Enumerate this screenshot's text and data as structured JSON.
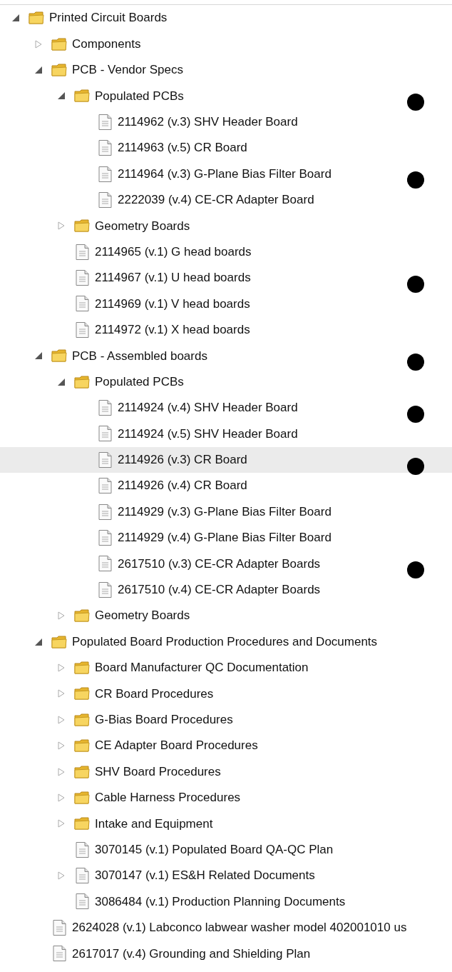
{
  "tree": [
    {
      "kind": "folder",
      "label": "Printed Circuit Boards",
      "expanded": true,
      "selected": false,
      "children": [
        {
          "kind": "folder",
          "label": "Components",
          "expanded": false,
          "selected": false
        },
        {
          "kind": "folder",
          "label": "PCB - Vendor Specs",
          "expanded": true,
          "selected": false,
          "children": [
            {
              "kind": "folder",
              "label": "Populated PCBs",
              "expanded": true,
              "selected": false,
              "dot": true,
              "children": [
                {
                  "kind": "file",
                  "label": "2114962 (v.3) SHV Header Board",
                  "selected": false
                },
                {
                  "kind": "file",
                  "label": "2114963 (v.5) CR Board",
                  "selected": false
                },
                {
                  "kind": "file",
                  "label": "2114964 (v.3) G-Plane Bias Filter Board",
                  "selected": false,
                  "dot": true
                },
                {
                  "kind": "file",
                  "label": "2222039 (v.4) CE-CR Adapter Board",
                  "selected": false
                }
              ]
            },
            {
              "kind": "folder",
              "label": "Geometry Boards",
              "expanded": false,
              "selected": false
            },
            {
              "kind": "file",
              "label": "2114965 (v.1) G head boards",
              "selected": false
            },
            {
              "kind": "file",
              "label": "2114967 (v.1) U head boards",
              "selected": false,
              "dot": true
            },
            {
              "kind": "file",
              "label": "2114969 (v.1) V head boards",
              "selected": false
            },
            {
              "kind": "file",
              "label": "2114972 (v.1) X head boards",
              "selected": false
            }
          ]
        },
        {
          "kind": "folder",
          "label": "PCB - Assembled boards",
          "expanded": true,
          "selected": false,
          "dot": true,
          "children": [
            {
              "kind": "folder",
              "label": "Populated PCBs",
              "expanded": true,
              "selected": false,
              "children": [
                {
                  "kind": "file",
                  "label": "2114924 (v.4) SHV Header Board",
                  "selected": false,
                  "dot": true
                },
                {
                  "kind": "file",
                  "label": "2114924 (v.5) SHV Header Board",
                  "selected": false
                },
                {
                  "kind": "file",
                  "label": "2114926 (v.3) CR Board",
                  "selected": true,
                  "dot": true
                },
                {
                  "kind": "file",
                  "label": "2114926 (v.4) CR Board",
                  "selected": false
                },
                {
                  "kind": "file",
                  "label": "2114929 (v.3) G-Plane Bias Filter Board",
                  "selected": false
                },
                {
                  "kind": "file",
                  "label": "2114929 (v.4) G-Plane Bias Filter Board",
                  "selected": false
                },
                {
                  "kind": "file",
                  "label": "2617510 (v.3) CE-CR Adapter Boards",
                  "selected": false,
                  "dot": true
                },
                {
                  "kind": "file",
                  "label": "2617510 (v.4) CE-CR Adapter Boards",
                  "selected": false
                }
              ]
            },
            {
              "kind": "folder",
              "label": "Geometry Boards",
              "expanded": false,
              "selected": false
            }
          ]
        },
        {
          "kind": "folder",
          "label": "Populated Board Production Procedures and Documents",
          "expanded": true,
          "selected": false,
          "children": [
            {
              "kind": "folder",
              "label": "Board Manufacturer QC Documentation",
              "expanded": false,
              "selected": false
            },
            {
              "kind": "folder",
              "label": "CR Board Procedures",
              "expanded": false,
              "selected": false
            },
            {
              "kind": "folder",
              "label": "G-Bias Board Procedures",
              "expanded": false,
              "selected": false
            },
            {
              "kind": "folder",
              "label": "CE Adapter Board Procedures",
              "expanded": false,
              "selected": false
            },
            {
              "kind": "folder",
              "label": "SHV Board Procedures",
              "expanded": false,
              "selected": false
            },
            {
              "kind": "folder",
              "label": "Cable Harness Procedures",
              "expanded": false,
              "selected": false
            },
            {
              "kind": "folder",
              "label": "Intake and Equipment",
              "expanded": false,
              "selected": false
            },
            {
              "kind": "file",
              "label": "3070145 (v.1) Populated Board QA-QC Plan",
              "selected": false
            },
            {
              "kind": "file",
              "label": "3070147 (v.1) ES&H Related Documents",
              "expanded": false,
              "selected": false
            },
            {
              "kind": "file",
              "label": "3086484 (v.1) Production Planning Documents",
              "selected": false
            }
          ]
        },
        {
          "kind": "file",
          "label": "2624028 (v.1) Labconco labwear washer model 402001010 us",
          "selected": false
        },
        {
          "kind": "file",
          "label": "2617017 (v.4) Grounding and Shielding Plan",
          "selected": false
        }
      ]
    }
  ]
}
